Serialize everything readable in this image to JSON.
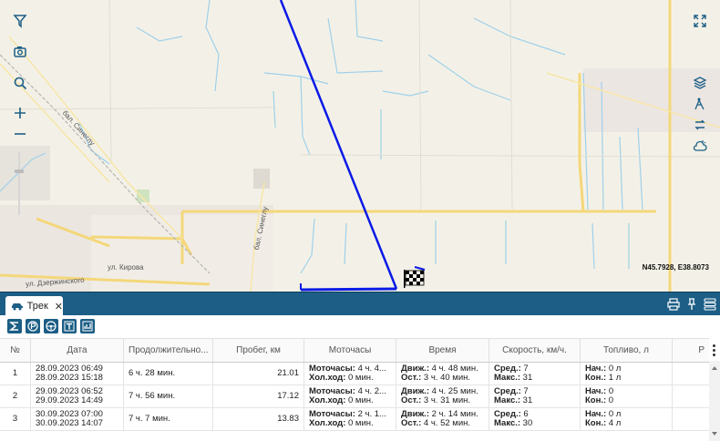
{
  "map": {
    "streets": [
      "бал. Синеглу",
      "бал. Синеглу",
      "ул. Кирова",
      "ул. Дзержинского"
    ],
    "coordinates": "N45.7928, E38.8073",
    "track_color": "#0000ff"
  },
  "panel": {
    "tab_label": "Трек",
    "tab_close": "✕"
  },
  "table": {
    "headers": [
      "№",
      "Дата",
      "Продолжительно...",
      "Пробег, км",
      "Моточасы",
      "Время",
      "Скорость, км/ч.",
      "Топливо, л",
      "Р"
    ],
    "rows": [
      {
        "num": "1",
        "date1": "28.09.2023 06:49",
        "date2": "28.09.2023 15:18",
        "duration": "6 ч. 28 мин.",
        "distance": "21.01",
        "moto_label": "Моточасы:",
        "moto_value": " 4 ч. 4...",
        "idle_label": "Хол.ход:",
        "idle_value": " 0 мин.",
        "move_label": "Движ.:",
        "move_value": " 4 ч. 48 мин.",
        "stop_label": "Ост.:",
        "stop_value": " 3 ч. 40 мин.",
        "avg_label": "Сред.:",
        "avg_value": " 7",
        "max_label": "Макс.:",
        "max_value": " 31",
        "fuel_start_label": "Нач.:",
        "fuel_start_value": " 0 л",
        "fuel_end_label": "Кон.:",
        "fuel_end_value": " 1 л"
      },
      {
        "num": "2",
        "date1": "29.09.2023 06:52",
        "date2": "29.09.2023 14:49",
        "duration": "7 ч. 56 мин.",
        "distance": "17.12",
        "moto_label": "Моточасы:",
        "moto_value": " 4 ч. 2...",
        "idle_label": "Хол.ход:",
        "idle_value": " 0 мин.",
        "move_label": "Движ.:",
        "move_value": " 4 ч. 25 мин.",
        "stop_label": "Ост.:",
        "stop_value": " 3 ч. 31 мин.",
        "avg_label": "Сред.:",
        "avg_value": " 7",
        "max_label": "Макс.:",
        "max_value": " 31",
        "fuel_start_label": "Нач.:",
        "fuel_start_value": " 0",
        "fuel_end_label": "Кон.:",
        "fuel_end_value": " 0"
      },
      {
        "num": "3",
        "date1": "30.09.2023 07:00",
        "date2": "30.09.2023 14:07",
        "duration": "7 ч. 7 мин.",
        "distance": "13.83",
        "moto_label": "Моточасы:",
        "moto_value": " 2 ч. 1...",
        "idle_label": "Хол.ход:",
        "idle_value": " 0 мин.",
        "move_label": "Движ.:",
        "move_value": " 2 ч. 14 мин.",
        "stop_label": "Ост.:",
        "stop_value": " 4 ч. 52 мин.",
        "avg_label": "Сред.:",
        "avg_value": " 6",
        "max_label": "Макс.:",
        "max_value": " 30",
        "fuel_start_label": "Нач.:",
        "fuel_start_value": " 0 л",
        "fuel_end_label": "Кон.:",
        "fuel_end_value": " 4 л"
      }
    ]
  }
}
